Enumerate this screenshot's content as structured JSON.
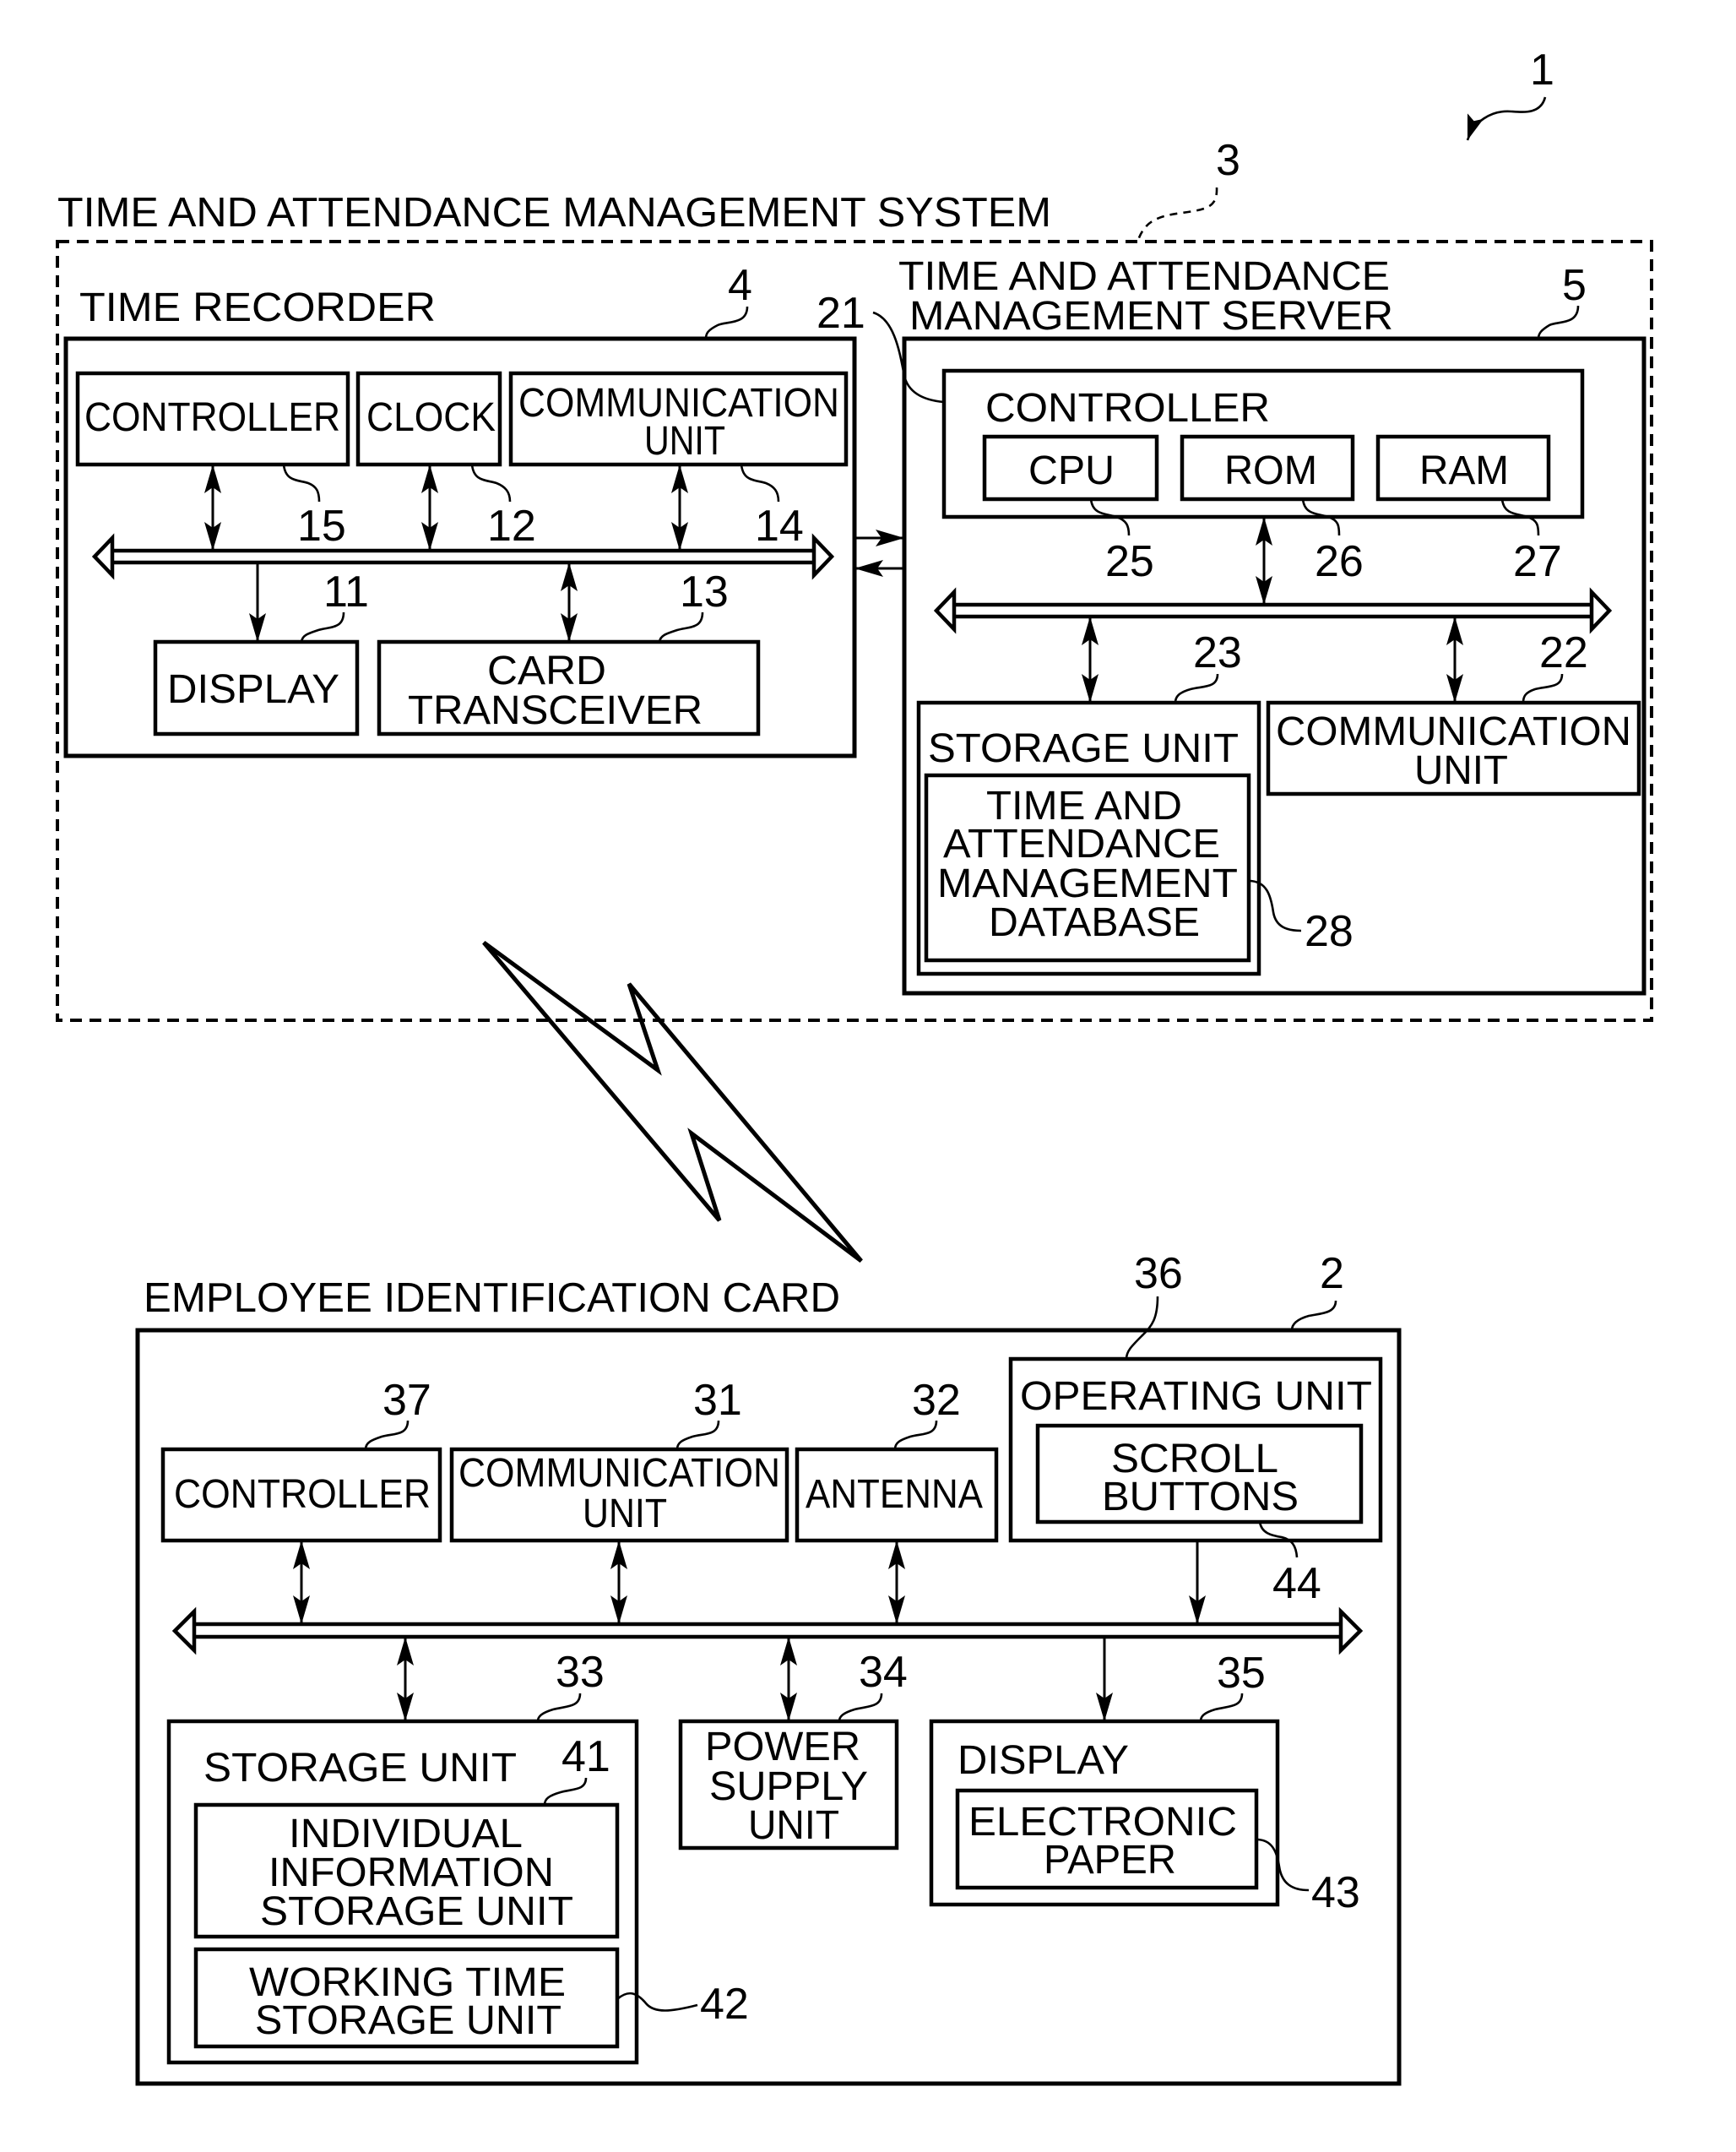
{
  "figure": {
    "reference": "1"
  },
  "system": {
    "title": "TIME AND ATTENDANCE MANAGEMENT SYSTEM",
    "ref": "3"
  },
  "time_recorder": {
    "title": "TIME RECORDER",
    "ref": "4",
    "controller": {
      "label": "CONTROLLER",
      "ref": "15"
    },
    "clock": {
      "label": "CLOCK",
      "ref": "12"
    },
    "communication_unit": {
      "label": [
        "COMMUNICATION",
        "UNIT"
      ],
      "ref": "14"
    },
    "display": {
      "label": "DISPLAY",
      "ref": "11"
    },
    "card_transceiver": {
      "label": [
        "CARD",
        "TRANSCEIVER"
      ],
      "ref": "13"
    }
  },
  "server": {
    "title": [
      "TIME AND ATTENDANCE",
      "MANAGEMENT SERVER"
    ],
    "ref": "5",
    "controller": {
      "label": "CONTROLLER",
      "ref": "21",
      "cpu": {
        "label": "CPU",
        "ref": "25"
      },
      "rom": {
        "label": "ROM",
        "ref": "26"
      },
      "ram": {
        "label": "RAM",
        "ref": "27"
      }
    },
    "storage_unit": {
      "label": "STORAGE UNIT",
      "ref": "23",
      "database": {
        "label": [
          "TIME AND",
          "ATTENDANCE",
          "MANAGEMENT",
          "DATABASE"
        ],
        "ref": "28"
      }
    },
    "communication_unit": {
      "label": [
        "COMMUNICATION",
        "UNIT"
      ],
      "ref": "22"
    }
  },
  "wireless_link": {
    "icon": "lightning-bolt-icon"
  },
  "card": {
    "title": "EMPLOYEE IDENTIFICATION CARD",
    "ref": "2",
    "controller": {
      "label": "CONTROLLER",
      "ref": "37"
    },
    "communication_unit": {
      "label": [
        "COMMUNICATION",
        "UNIT"
      ],
      "ref": "31"
    },
    "antenna": {
      "label": "ANTENNA",
      "ref": "32"
    },
    "operating_unit": {
      "label": "OPERATING UNIT",
      "ref": "36",
      "scroll_buttons": {
        "label": [
          "SCROLL",
          "BUTTONS"
        ],
        "ref": "44"
      }
    },
    "storage_unit": {
      "label": "STORAGE UNIT",
      "ref": "33",
      "individual_info": {
        "label": [
          "INDIVIDUAL",
          "INFORMATION",
          "STORAGE UNIT"
        ],
        "ref": "41"
      },
      "working_time": {
        "label": [
          "WORKING TIME",
          "STORAGE UNIT"
        ],
        "ref": "42"
      }
    },
    "power_supply": {
      "label": [
        "POWER",
        "SUPPLY",
        "UNIT"
      ],
      "ref": "34"
    },
    "display": {
      "label": "DISPLAY",
      "ref": "35",
      "electronic_paper": {
        "label": [
          "ELECTRONIC",
          "PAPER"
        ],
        "ref": "43"
      }
    }
  }
}
